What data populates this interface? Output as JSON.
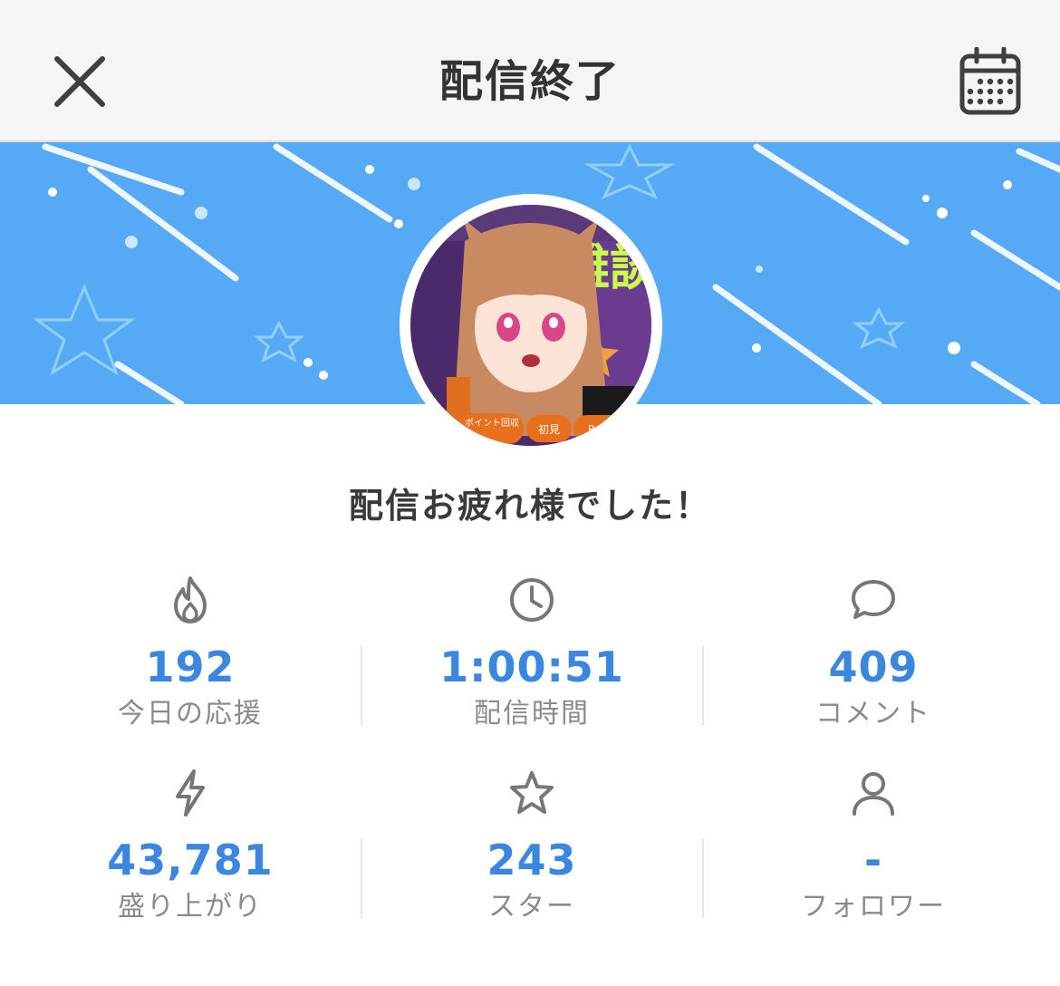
{
  "header": {
    "title": "配信終了",
    "close_icon": "close-icon",
    "calendar_icon": "calendar-icon"
  },
  "banner": {
    "background_color": "#56aaf5",
    "thumbnail_texts": [
      "雑談",
      "ポイント回収",
      "初見",
      "ROM"
    ]
  },
  "message": "配信お疲れ様でした！",
  "stats": [
    {
      "icon": "flame-icon",
      "value": "192",
      "label": "今日の応援"
    },
    {
      "icon": "clock-icon",
      "value": "1:00:51",
      "label": "配信時間"
    },
    {
      "icon": "comment-icon",
      "value": "409",
      "label": "コメント"
    },
    {
      "icon": "lightning-icon",
      "value": "43,781",
      "label": "盛り上がり"
    },
    {
      "icon": "star-icon",
      "value": "243",
      "label": "スター"
    },
    {
      "icon": "person-icon",
      "value": "-",
      "label": "フォロワー"
    }
  ],
  "colors": {
    "accent": "#3b86e0",
    "label": "#8a8a8a",
    "icon": "#777777"
  }
}
